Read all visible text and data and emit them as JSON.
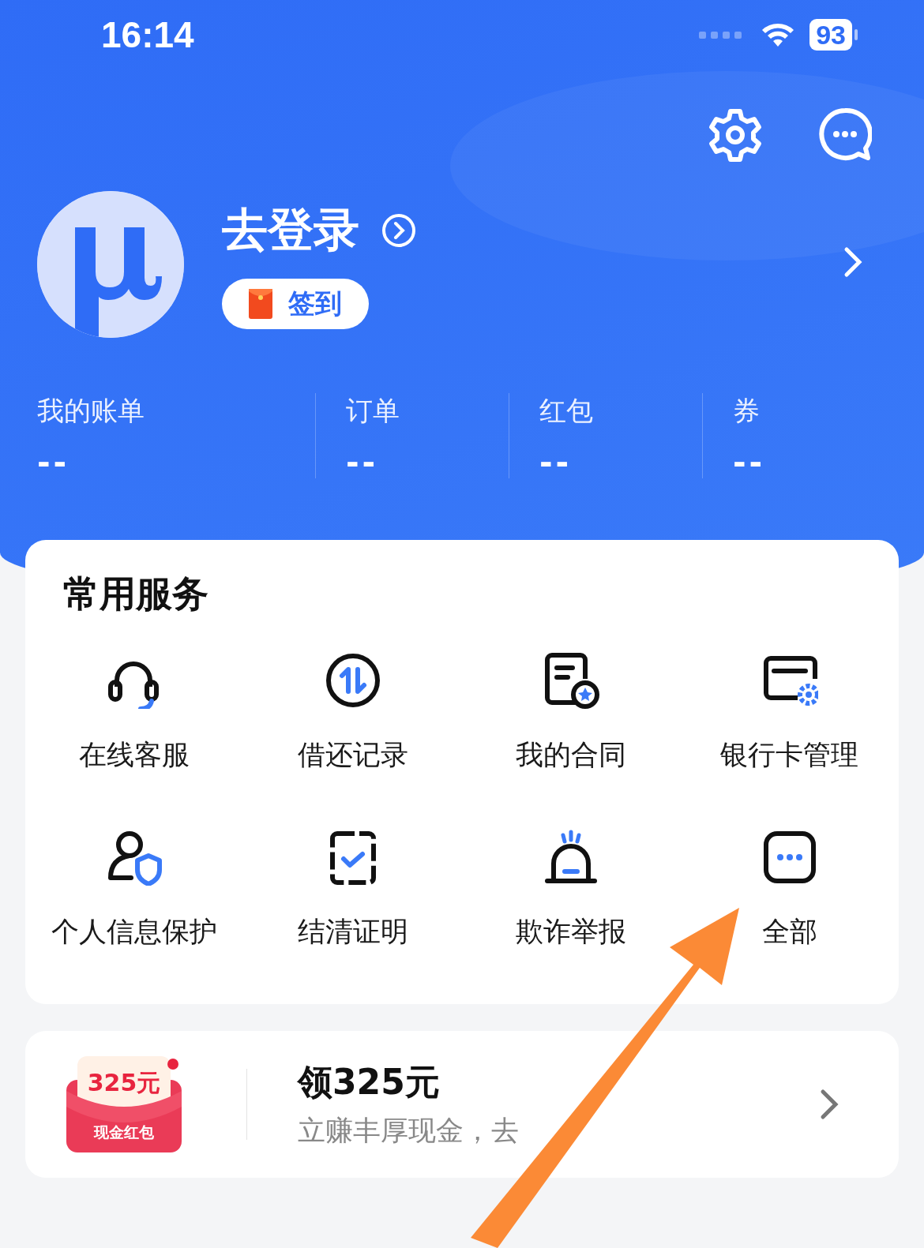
{
  "status_bar": {
    "time": "16:14",
    "battery": "93"
  },
  "profile": {
    "login": "去登录",
    "checkin": "签到"
  },
  "stats": [
    {
      "label": "我的账单",
      "value": "--"
    },
    {
      "label": "订单",
      "value": "--"
    },
    {
      "label": "红包",
      "value": "--"
    },
    {
      "label": "券",
      "value": "--"
    }
  ],
  "services": {
    "title": "常用服务",
    "items": [
      {
        "label": "在线客服",
        "kind": "headset"
      },
      {
        "label": "借还记录",
        "kind": "transfer"
      },
      {
        "label": "我的合同",
        "kind": "contract"
      },
      {
        "label": "银行卡管理",
        "kind": "card"
      },
      {
        "label": "个人信息保护",
        "kind": "privacy"
      },
      {
        "label": "结清证明",
        "kind": "clipboard"
      },
      {
        "label": "欺诈举报",
        "kind": "alarm"
      },
      {
        "label": "全部",
        "kind": "more"
      }
    ]
  },
  "promo": {
    "badge_amount": "325元",
    "badge_label": "现金红包",
    "title": "领325元",
    "subtitle": "立赚丰厚现金，去"
  }
}
